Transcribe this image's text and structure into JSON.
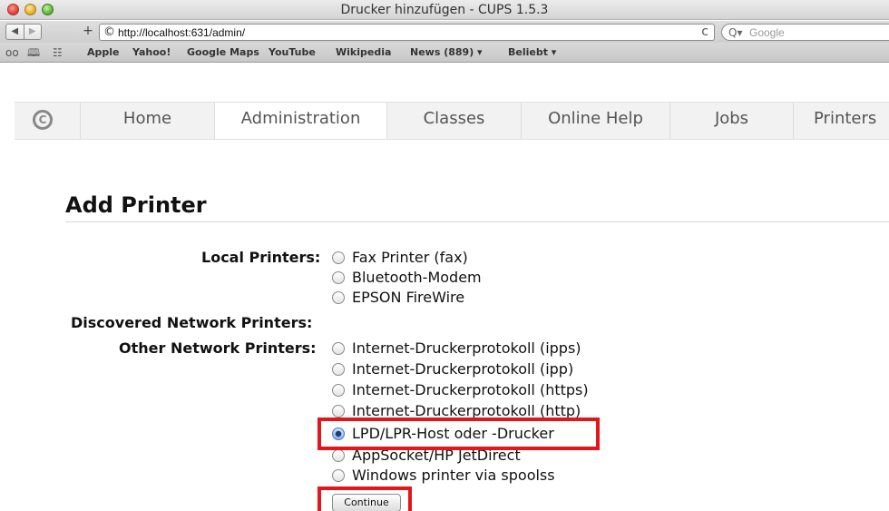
{
  "window": {
    "title": "Drucker hinzufügen - CUPS 1.5.3"
  },
  "toolbar": {
    "back": "◀",
    "forward": "▶",
    "new_tab": "+",
    "url": "http://localhost:631/admin/",
    "reload": "c",
    "search_placeholder": "Google"
  },
  "bookmarks": {
    "items": [
      "Apple",
      "Yahoo!",
      "Google Maps",
      "YouTube",
      "Wikipedia",
      "News (889) ▾",
      "Beliebt ▾"
    ]
  },
  "cups_nav": {
    "tabs": [
      "Home",
      "Administration",
      "Classes",
      "Online Help",
      "Jobs",
      "Printers"
    ],
    "active": "Administration"
  },
  "page": {
    "title": "Add Printer",
    "local_label": "Local Printers:",
    "local_options": [
      "Fax Printer (fax)",
      "Bluetooth-Modem",
      "EPSON FireWire"
    ],
    "discovered_label": "Discovered Network Printers:",
    "other_label": "Other Network Printers:",
    "other_options": [
      "Internet-Druckerprotokoll (ipps)",
      "Internet-Druckerprotokoll (ipp)",
      "Internet-Druckerprotokoll (https)",
      "Internet-Druckerprotokoll (http)",
      "LPD/LPR-Host oder -Drucker",
      "AppSocket/HP JetDirect",
      "Windows printer via spoolss"
    ],
    "selected": "LPD/LPR-Host oder -Drucker",
    "continue_label": "Continue"
  },
  "colors": {
    "highlight": "#e4151b"
  }
}
